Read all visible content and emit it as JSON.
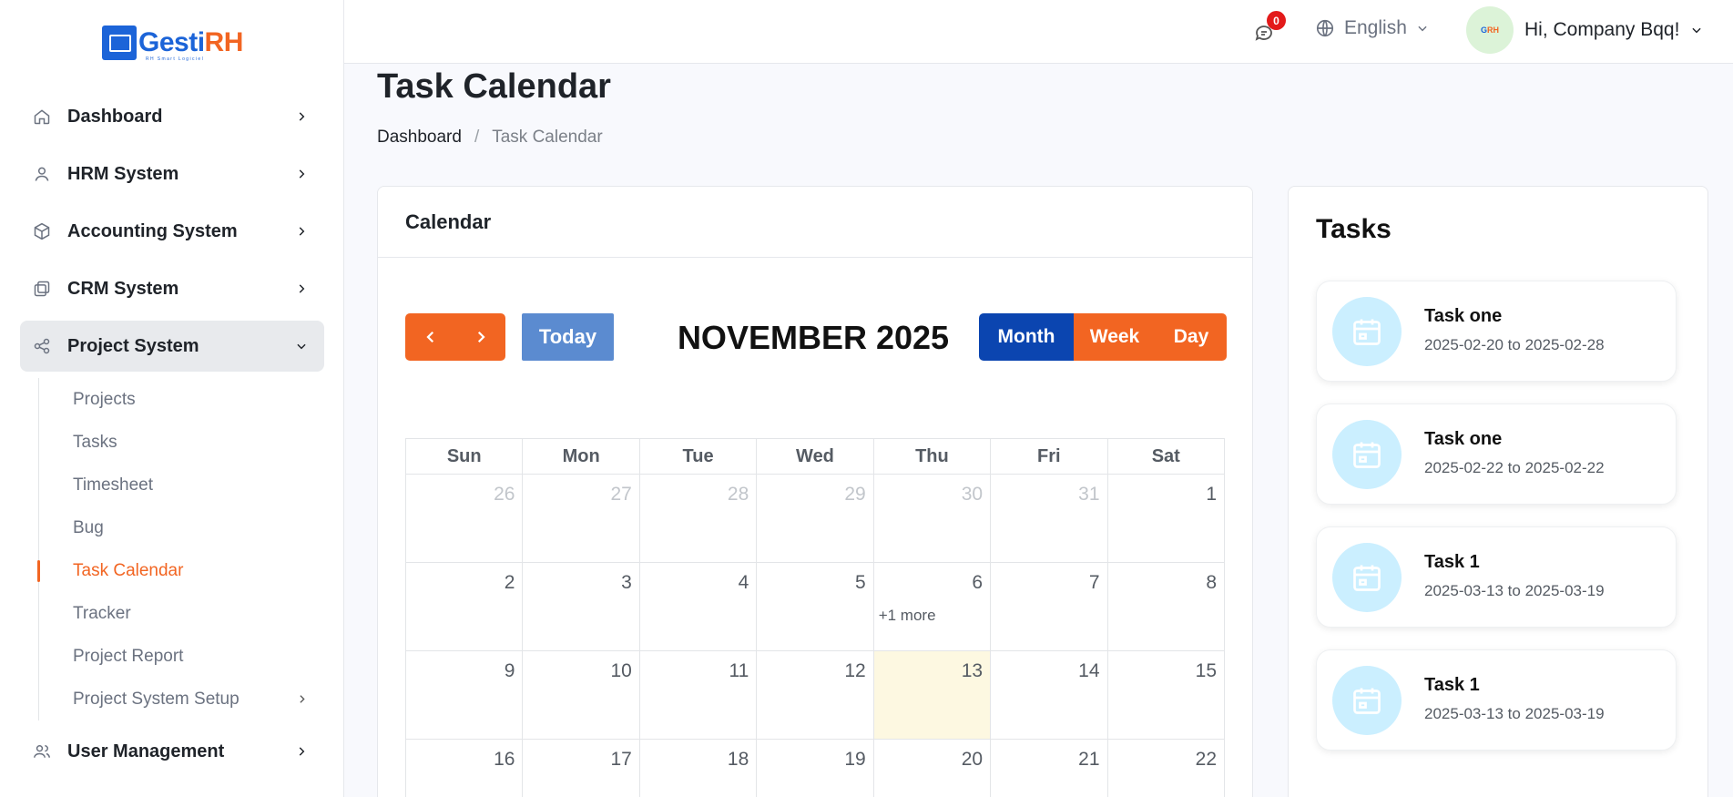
{
  "logo": {
    "name_part1": "Gesti",
    "name_part2": "RH",
    "tagline": "RH Smart Logiciel"
  },
  "sidebar": {
    "items": [
      {
        "label": "Dashboard",
        "icon": "home-icon"
      },
      {
        "label": "HRM System",
        "icon": "user-icon"
      },
      {
        "label": "Accounting System",
        "icon": "box-icon"
      },
      {
        "label": "CRM System",
        "icon": "layers-icon"
      },
      {
        "label": "Project System",
        "icon": "share-icon",
        "expanded": true
      },
      {
        "label": "User Management",
        "icon": "users-icon"
      }
    ],
    "project_subitems": [
      {
        "label": "Projects"
      },
      {
        "label": "Tasks"
      },
      {
        "label": "Timesheet"
      },
      {
        "label": "Bug"
      },
      {
        "label": "Task Calendar",
        "active": true
      },
      {
        "label": "Tracker"
      },
      {
        "label": "Project Report"
      },
      {
        "label": "Project System Setup"
      }
    ]
  },
  "topbar": {
    "message_count": "0",
    "language": "English",
    "greeting": "Hi, Company Bqq!"
  },
  "page": {
    "title": "Task Calendar",
    "breadcrumb": [
      "Dashboard",
      "/",
      "Task Calendar"
    ]
  },
  "calendar": {
    "card_title": "Calendar",
    "today_label": "Today",
    "month_title": "NOVEMBER 2025",
    "views": {
      "month": "Month",
      "week": "Week",
      "day": "Day"
    },
    "weekdays": [
      "Sun",
      "Mon",
      "Tue",
      "Wed",
      "Thu",
      "Fri",
      "Sat"
    ],
    "weeks": [
      [
        {
          "d": "26",
          "other": true
        },
        {
          "d": "27",
          "other": true
        },
        {
          "d": "28",
          "other": true
        },
        {
          "d": "29",
          "other": true
        },
        {
          "d": "30",
          "other": true
        },
        {
          "d": "31",
          "other": true
        },
        {
          "d": "1"
        }
      ],
      [
        {
          "d": "2"
        },
        {
          "d": "3"
        },
        {
          "d": "4"
        },
        {
          "d": "5"
        },
        {
          "d": "6",
          "more": "+1 more"
        },
        {
          "d": "7"
        },
        {
          "d": "8"
        }
      ],
      [
        {
          "d": "9"
        },
        {
          "d": "10"
        },
        {
          "d": "11"
        },
        {
          "d": "12"
        },
        {
          "d": "13",
          "today": true
        },
        {
          "d": "14"
        },
        {
          "d": "15"
        }
      ],
      [
        {
          "d": "16"
        },
        {
          "d": "17"
        },
        {
          "d": "18"
        },
        {
          "d": "19"
        },
        {
          "d": "20"
        },
        {
          "d": "21"
        },
        {
          "d": "22"
        }
      ]
    ]
  },
  "tasks": {
    "title": "Tasks",
    "items": [
      {
        "name": "Task one",
        "dates": "2025-02-20 to 2025-02-28"
      },
      {
        "name": "Task one",
        "dates": "2025-02-22 to 2025-02-22"
      },
      {
        "name": "Task 1",
        "dates": "2025-03-13 to 2025-03-19"
      },
      {
        "name": "Task 1",
        "dates": "2025-03-13 to 2025-03-19"
      }
    ]
  },
  "colors": {
    "accent": "#f26522",
    "primary": "#0b45b0",
    "today_bg": "#fdf8e1",
    "task_icon_bg": "#cbefff"
  }
}
